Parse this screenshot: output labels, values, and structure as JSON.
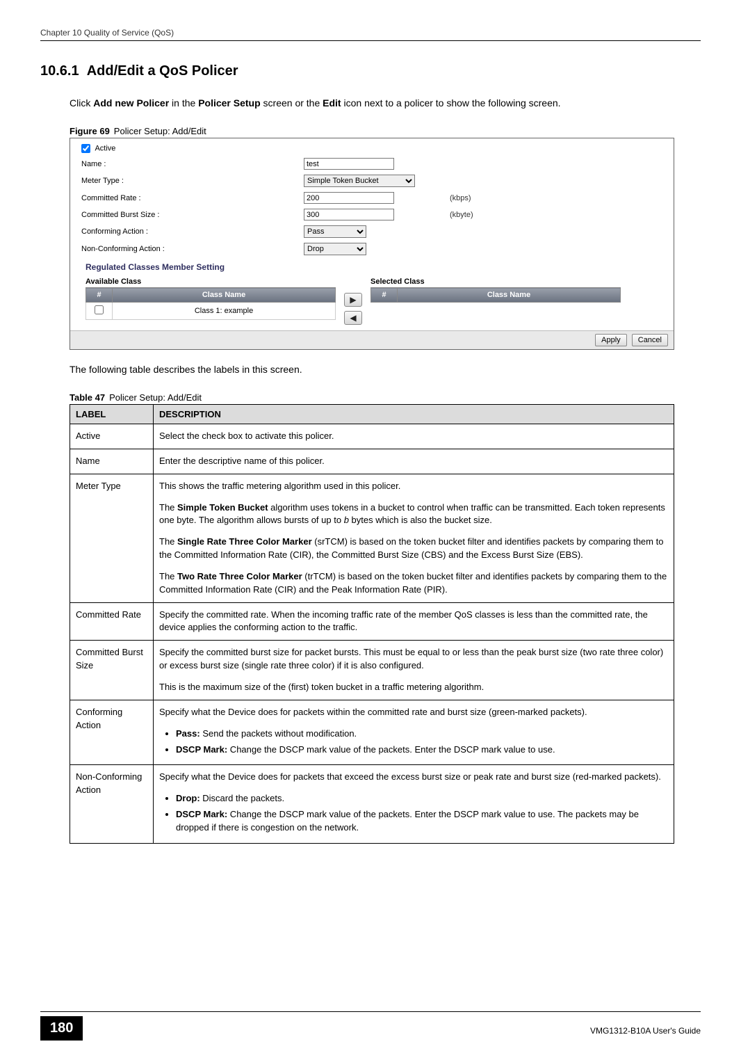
{
  "header": {
    "running": "Chapter 10 Quality of Service (QoS)"
  },
  "section": {
    "number": "10.6.1",
    "title": "Add/Edit a QoS Policer"
  },
  "intro": {
    "prefix": "Click ",
    "bold1": "Add new Policer",
    "middle1": " in the ",
    "bold2": "Policer Setup",
    "middle2": " screen or the ",
    "bold3": "Edit",
    "suffix": " icon next to a policer to show the following screen."
  },
  "figure": {
    "label": "Figure 69",
    "caption": "Policer Setup: Add/Edit",
    "form": {
      "active_label": "Active",
      "active_checked": true,
      "name_label": "Name :",
      "name_value": "test",
      "meter_label": "Meter Type :",
      "meter_value": "Simple Token Bucket",
      "crate_label": "Committed Rate :",
      "crate_value": "200",
      "crate_unit": "(kbps)",
      "cbs_label": "Committed Burst Size :",
      "cbs_value": "300",
      "cbs_unit": "(kbyte)",
      "conf_label": "Conforming Action :",
      "conf_value": "Pass",
      "nonconf_label": "Non-Conforming Action :",
      "nonconf_value": "Drop"
    },
    "regulated_heading": "Regulated Classes Member Setting",
    "available": {
      "title": "Available Class",
      "col_hash": "#",
      "col_name": "Class Name",
      "row1_name": "Class 1: example"
    },
    "selected": {
      "title": "Selected Class",
      "col_hash": "#",
      "col_name": "Class Name"
    },
    "arrows": {
      "right": "▶",
      "left": "◀"
    },
    "buttons": {
      "apply": "Apply",
      "cancel": "Cancel"
    }
  },
  "after_figure_text": "The following table describes the labels in this screen.",
  "table": {
    "label": "Table 47",
    "caption": "Policer Setup: Add/Edit",
    "head_label": "LABEL",
    "head_desc": "DESCRIPTION",
    "rows": [
      {
        "label": "Active",
        "paras": [
          "Select the check box to activate this policer."
        ]
      },
      {
        "label": "Name",
        "paras": [
          "Enter the descriptive name of this policer."
        ]
      },
      {
        "label": "Meter Type",
        "p1": "This shows the traffic metering algorithm used in this policer.",
        "p2_a": "The ",
        "p2_b": "Simple Token Bucket",
        "p2_c": " algorithm uses tokens in a bucket to control when traffic can be transmitted. Each token represents one byte. The algorithm allows bursts of up to ",
        "p2_i": "b",
        "p2_d": " bytes which is also the bucket size.",
        "p3_a": "The ",
        "p3_b": "Single Rate Three Color Marker",
        "p3_c": " (srTCM) is based on the token bucket filter and identifies packets by comparing them to the Committed Information Rate (CIR), the Committed Burst Size (CBS) and the Excess Burst Size (EBS).",
        "p4_a": "The ",
        "p4_b": "Two Rate Three Color Marker",
        "p4_c": " (trTCM) is based on the token bucket filter and identifies packets by comparing them to the Committed Information Rate (CIR) and the Peak Information Rate (PIR)."
      },
      {
        "label": "Committed Rate",
        "paras": [
          "Specify the committed rate. When the incoming traffic rate of the member QoS classes is less than the committed rate, the device applies the conforming action to the traffic."
        ]
      },
      {
        "label": "Committed Burst Size",
        "paras": [
          "Specify the committed burst size for packet bursts. This must be equal to or less than the peak burst size (two rate three color) or excess burst size (single rate three color) if it is also configured.",
          "This is the maximum size of the (first) token bucket in a traffic metering algorithm."
        ]
      },
      {
        "label": "Conforming Action",
        "intro": "Specify what the Device does for packets within the committed rate and burst size (green-marked packets).",
        "bullets": [
          {
            "b": "Pass:",
            "t": " Send the packets without modification."
          },
          {
            "b": "DSCP Mark:",
            "t": " Change the DSCP mark value of the packets. Enter the DSCP mark value to use."
          }
        ]
      },
      {
        "label": "Non-Conforming Action",
        "intro": "Specify what the Device does for packets that exceed the excess burst size or peak rate and burst size (red-marked packets).",
        "bullets": [
          {
            "b": "Drop:",
            "t": " Discard the packets."
          },
          {
            "b": "DSCP Mark:",
            "t": " Change the DSCP mark value of the packets. Enter the DSCP mark value to use. The packets may be dropped if there is congestion on the network."
          }
        ]
      }
    ]
  },
  "footer": {
    "page": "180",
    "guide": "VMG1312-B10A User's Guide"
  }
}
